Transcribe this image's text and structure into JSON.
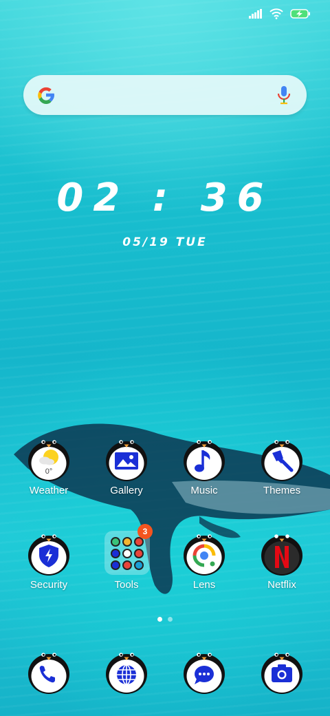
{
  "status": {
    "signal_icon": "signal-bars-icon",
    "wifi_icon": "wifi-icon",
    "battery_icon": "battery-charging-icon"
  },
  "search": {
    "logo_icon": "google-g-icon",
    "mic_icon": "microphone-icon"
  },
  "clock": {
    "time": "02 : 36",
    "date": "05/19 TUE"
  },
  "apps_row1": [
    {
      "label": "Weather",
      "icon": "weather-icon",
      "temp": "0°"
    },
    {
      "label": "Gallery",
      "icon": "gallery-icon"
    },
    {
      "label": "Music",
      "icon": "music-note-icon"
    },
    {
      "label": "Themes",
      "icon": "paintbrush-icon"
    }
  ],
  "apps_row2": [
    {
      "label": "Security",
      "icon": "security-shield-icon"
    },
    {
      "label": "Tools",
      "icon": "folder-icon",
      "badge": "3"
    },
    {
      "label": "Lens",
      "icon": "lens-icon"
    },
    {
      "label": "Netflix",
      "icon": "netflix-icon"
    }
  ],
  "dock": [
    {
      "icon": "phone-icon"
    },
    {
      "icon": "globe-icon"
    },
    {
      "icon": "messages-icon"
    },
    {
      "icon": "camera-icon"
    }
  ],
  "page_indicator": {
    "pages": 2,
    "current": 1
  },
  "colors": {
    "accent_blue": "#1a2fd6",
    "badge": "#f4541f",
    "netflix_red": "#e50914"
  }
}
